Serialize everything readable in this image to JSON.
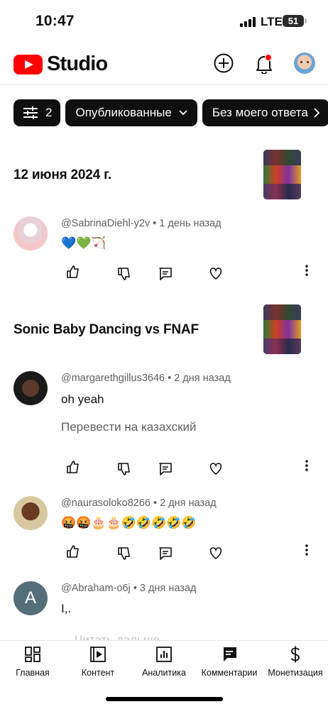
{
  "status_bar": {
    "time": "10:47",
    "network": "LTE",
    "battery": "51"
  },
  "app_bar": {
    "logo_text": "Studio",
    "icons": [
      "youtube-logo-icon",
      "create-plus-icon",
      "bell-icon",
      "avatar"
    ]
  },
  "filters": {
    "filter_count": "2",
    "chips": [
      {
        "label": "Опубликованные"
      },
      {
        "label": "Без моего ответа"
      }
    ]
  },
  "videos": [
    {
      "title": "12 июня 2024 г.",
      "comments": [
        {
          "author": "@SabrinaDiehl-y2v",
          "time": "1 день назад",
          "text": "💙💚🏹",
          "translate": ""
        }
      ]
    },
    {
      "title": "Sonic Baby Dancing vs FNAF",
      "comments": [
        {
          "author": "@margarethgillus3646",
          "time": "2 дня назад",
          "text": "oh yeah",
          "translate": "Перевести на казахский"
        },
        {
          "author": "@naurasoloko8266",
          "time": "2 дня назад",
          "text": "🤬🤬🎂🎂🤣🤣🤣🤣🤣",
          "translate": ""
        },
        {
          "author": "@Abraham-o6j",
          "time": "3 дня назад",
          "text": "I,.",
          "translate": "",
          "avatar_letter": "A"
        }
      ]
    }
  ],
  "partial_text": "Читать дальше",
  "bottom_nav": [
    {
      "label": "Главная",
      "icon": "dashboard-icon"
    },
    {
      "label": "Контент",
      "icon": "content-icon"
    },
    {
      "label": "Аналитика",
      "icon": "analytics-icon"
    },
    {
      "label": "Комментарии",
      "icon": "comments-icon"
    },
    {
      "label": "Монетизация",
      "icon": "dollar-icon"
    }
  ],
  "colors": {
    "brand_red": "#ff0000",
    "chip_bg": "#0f0f0f",
    "secondary_text": "#606060"
  }
}
